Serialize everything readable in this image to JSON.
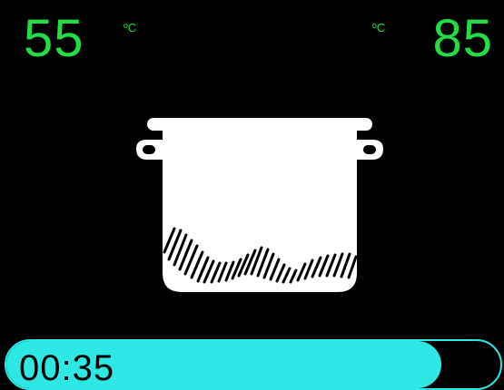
{
  "temperature": {
    "left": {
      "value": "55",
      "unit": "ºC"
    },
    "right": {
      "value": "85",
      "unit": "ºC"
    }
  },
  "pot": {
    "icon": "pot-icon"
  },
  "timer": {
    "time": "00:35",
    "progress_percent": 88
  },
  "colors": {
    "temperature": "#22dd44",
    "progress": "#2ee8e6",
    "background": "#000000",
    "pot": "#ffffff"
  }
}
